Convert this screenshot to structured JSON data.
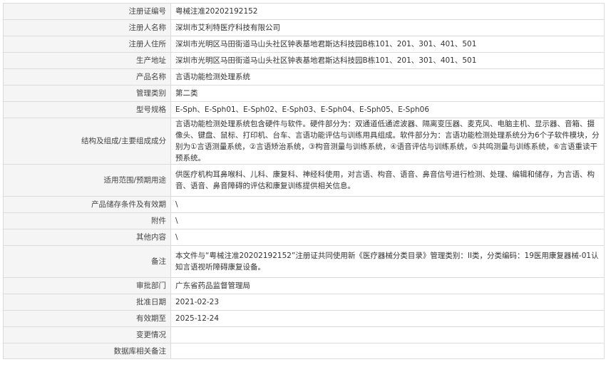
{
  "record": {
    "fields": [
      {
        "key": "reg_no",
        "label": "注册证编号",
        "value": "粤械注准20202192152"
      },
      {
        "key": "registrant_name",
        "label": "注册人名称",
        "value": "深圳市艾利特医疗科技有限公司"
      },
      {
        "key": "registrant_address",
        "label": "注册人住所",
        "value": "深圳市光明区马田街道马山头社区钟表基地君斯达科技园B栋101、201、301、401、501"
      },
      {
        "key": "production_address",
        "label": "生产地址",
        "value": "深圳市光明区马田街道马山头社区钟表基地君斯达科技园B栋101、201、301、401、501"
      },
      {
        "key": "product_name",
        "label": "产品名称",
        "value": "言语功能检测处理系统"
      },
      {
        "key": "management_class",
        "label": "管理类别",
        "value": "第二类"
      },
      {
        "key": "model_spec",
        "label": "型号规格",
        "value": "E-Sph、E-Sph01、E-Sph02、E-Sph03、E-Sph04、E-Sph05、E-Sph06"
      },
      {
        "key": "structure_composition",
        "label": "结构及组成/主要组成成分",
        "value": "言语功能检测处理系统包含硬件与软件。硬件部分为：双通道低通滤波器、隔离变压器、麦克风、电脑主机、显示器、音箱、摄像头、键盘、鼠标、打印机、台车、言语功能评估与训练用具组成。软件部分为：言语功能检测处理系统分为6个子软件模块，分别为①言语测量系统，②言语矫治系统，③构音测量与训练系统，④语音评估与训练系统，⑤共鸣测量与训练系统，⑥言语重读干预系统。"
      },
      {
        "key": "intended_use",
        "label": "适用范围/预期用途",
        "value": "供医疗机构耳鼻喉科、儿科、康复科、神经科使用，对言语、构音、语音、鼻音信号进行检测、处理、编辑和储存，为言语、构音、语音、鼻音障碍的评估和康复训练提供相关信息。"
      },
      {
        "key": "storage_validity",
        "label": "产品储存条件及有效期",
        "value": "\\"
      },
      {
        "key": "attachment",
        "label": "附件",
        "value": "\\"
      },
      {
        "key": "other_content",
        "label": "其他内容",
        "value": "\\"
      },
      {
        "key": "remarks",
        "label": "备注",
        "value": "本文件与“粤械注准20202192152”注册证共同使用新《医疗器械分类目录》管理类别：II类，分类编码：19医用康复器械-01认知言语视听障碍康复设备。"
      },
      {
        "key": "approval_dept",
        "label": "审批部门",
        "value": "广东省药品监督管理局"
      },
      {
        "key": "approval_date",
        "label": "批准日期",
        "value": "2021-02-23"
      },
      {
        "key": "valid_until",
        "label": "有效期至",
        "value": "2025-12-24"
      },
      {
        "key": "change_status",
        "label": "变更情况",
        "value": ""
      },
      {
        "key": "db_notes",
        "label": "数据库相关备注",
        "value": ""
      }
    ]
  }
}
